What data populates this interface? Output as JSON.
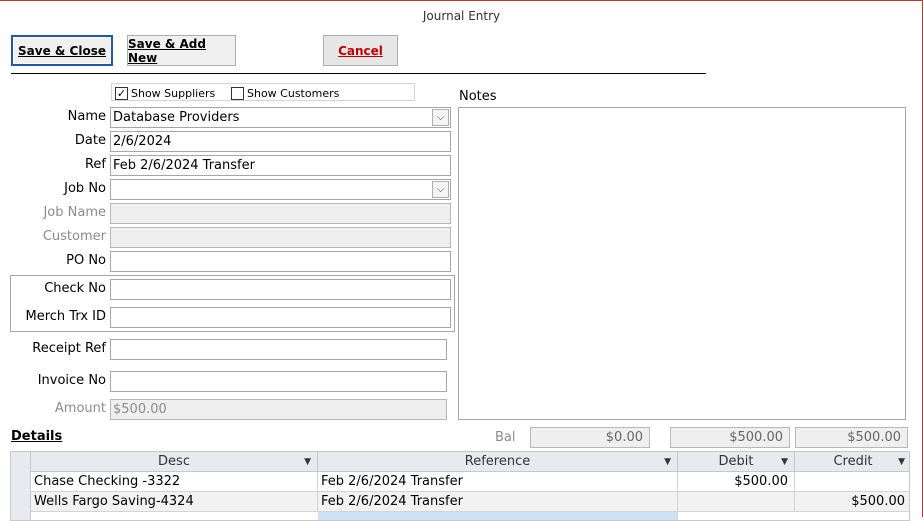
{
  "window": {
    "title": "Journal Entry"
  },
  "toolbar": {
    "save_close_label": "Save & Close",
    "save_add_label": "Save & Add New",
    "cancel_label": "Cancel"
  },
  "filters": {
    "show_suppliers_label": "Show Suppliers",
    "show_suppliers_checked": "✓",
    "show_customers_label": "Show Customers"
  },
  "form": {
    "name_label": "Name",
    "name_value": "Database Providers",
    "date_label": "Date",
    "date_value": "2/6/2024",
    "ref_label": "Ref",
    "ref_value": "Feb 2/6/2024 Transfer",
    "job_no_label": "Job No",
    "job_no_value": "",
    "job_name_label": "Job Name",
    "job_name_value": "",
    "customer_label": "Customer",
    "customer_value": "",
    "po_no_label": "PO No",
    "po_no_value": "",
    "check_no_label": "Check No",
    "check_no_value": "",
    "merch_trx_label": "Merch Trx ID",
    "merch_trx_value": "",
    "receipt_ref_label": "Receipt Ref",
    "receipt_ref_value": "",
    "invoice_no_label": "Invoice No",
    "invoice_no_value": "",
    "amount_label": "Amount",
    "amount_value": "$500.00"
  },
  "notes": {
    "label": "Notes",
    "value": ""
  },
  "details": {
    "label": "Details",
    "bal_label": "Bal",
    "bal_value": "$0.00",
    "debit_total": "$500.00",
    "credit_total": "$500.00",
    "columns": {
      "desc": "Desc",
      "reference": "Reference",
      "debit": "Debit",
      "credit": "Credit"
    },
    "rows": [
      {
        "desc": "Chase Checking -3322",
        "reference": "Feb 2/6/2024 Transfer",
        "debit": "$500.00",
        "credit": ""
      },
      {
        "desc": "Wells Fargo Saving-4324",
        "reference": "Feb 2/6/2024 Transfer",
        "debit": "",
        "credit": "$500.00"
      }
    ]
  },
  "icons": {
    "dropdown": "chevron-down-icon",
    "sort": "sort-down-icon"
  }
}
